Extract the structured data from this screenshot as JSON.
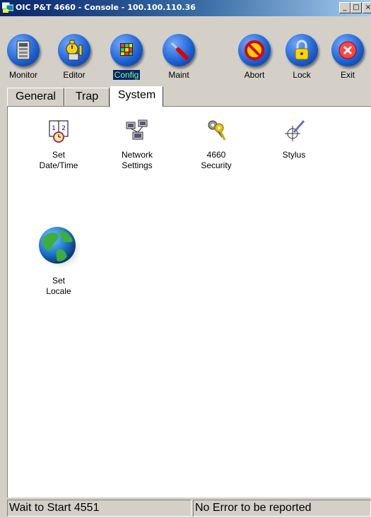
{
  "window": {
    "title": "OIC P&T 4660 - Console - 100.100.110.36",
    "minimize_glyph": "_",
    "maximize_glyph": "□",
    "close_glyph": "×"
  },
  "toolbar": {
    "buttons": [
      {
        "label": "Monitor",
        "icon": "monitor-icon",
        "color": "#1a5fd0"
      },
      {
        "label": "Editor",
        "icon": "editor-icon",
        "color": "#1a5fd0"
      },
      {
        "label": "Config",
        "icon": "config-icon",
        "color": "#1a5fd0",
        "active": true
      },
      {
        "label": "Maint",
        "icon": "maint-icon",
        "color": "#1a5fd0"
      },
      {
        "label": "Abort",
        "icon": "abort-icon",
        "color": "#1a5fd0"
      },
      {
        "label": "Lock",
        "icon": "lock-icon",
        "color": "#1a5fd0"
      },
      {
        "label": "Exit",
        "icon": "exit-icon",
        "color": "#1a5fd0"
      }
    ]
  },
  "tabs": [
    {
      "label": "General"
    },
    {
      "label": "Trap"
    },
    {
      "label": "System",
      "active": true
    }
  ],
  "system_items": [
    {
      "label_line1": "Set",
      "label_line2": "Date/Time",
      "icon": "calendar-clock-icon"
    },
    {
      "label_line1": "Network",
      "label_line2": "Settings",
      "icon": "network-icon"
    },
    {
      "label_line1": "4660",
      "label_line2": "Security",
      "icon": "keys-icon"
    },
    {
      "label_line1": "Stylus",
      "label_line2": "",
      "icon": "stylus-crosshair-icon"
    },
    {
      "label_line1": "Set",
      "label_line2": "Locale",
      "icon": "globe-icon"
    }
  ],
  "status": {
    "left": "Wait to Start 4551",
    "right": "No Error to be reported"
  }
}
